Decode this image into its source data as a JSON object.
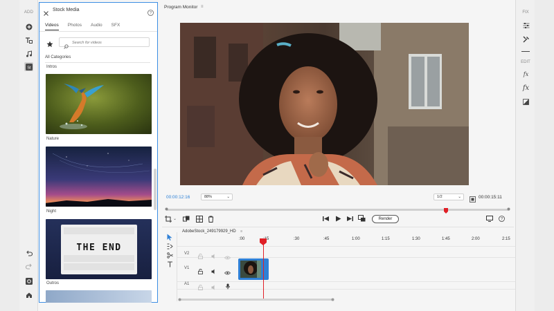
{
  "left_rail": {
    "add_label": "ADD",
    "stock_badge": "St"
  },
  "stock_panel": {
    "title": "Stock Media",
    "tabs": [
      {
        "label": "Videos",
        "active": true
      },
      {
        "label": "Photos",
        "active": false
      },
      {
        "label": "Audio",
        "active": false
      },
      {
        "label": "SFX",
        "active": false
      }
    ],
    "search_placeholder": "Search for videos",
    "category": "All Categories",
    "items": [
      {
        "label": "Intros"
      },
      {
        "label": "Nature"
      },
      {
        "label": "Night"
      },
      {
        "label": "Outros"
      }
    ],
    "lightbox_text": "THE END"
  },
  "program_monitor": {
    "title": "Program Monitor",
    "current_time": "00:00:12:16",
    "zoom": "88%",
    "quality": "1/2",
    "duration": "00:00:15:11",
    "render_label": "Render",
    "playhead_fraction": 0.81
  },
  "timeline": {
    "sequence_name": "AdobeStock_249179929_HD",
    "ruler": [
      ":00",
      ":15",
      ":30",
      ":45",
      "1:00",
      "1:15",
      "1:30",
      "1:45",
      "2:00",
      "2:15"
    ],
    "tracks": [
      {
        "name": "V2"
      },
      {
        "name": "V1"
      },
      {
        "name": "A1"
      }
    ]
  },
  "right_rail": {
    "fix_label": "FIX",
    "edit_label": "EDIT",
    "fx_glyph": "fx"
  },
  "colors": {
    "accent": "#2f80d6",
    "playhead": "#e01f26",
    "panel_border": "#3b8de3"
  }
}
